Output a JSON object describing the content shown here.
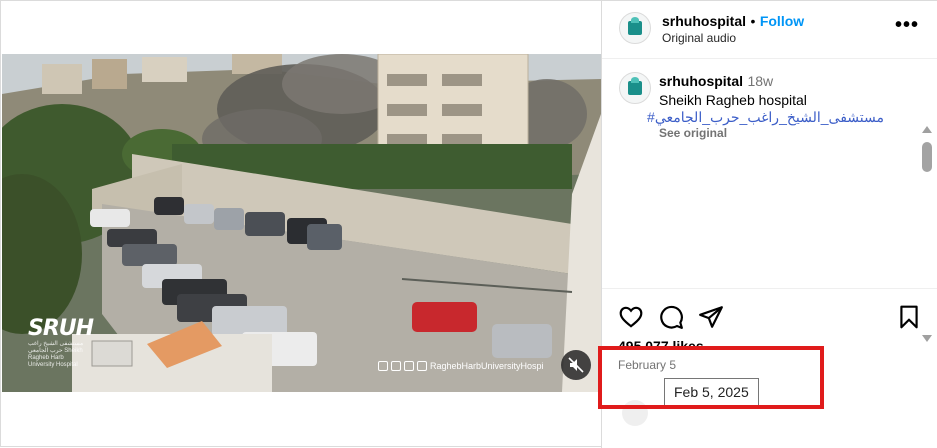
{
  "post": {
    "username": "srhuhospital",
    "separator": "•",
    "follow_label": "Follow",
    "audio": "Original audio",
    "more_label": "•••"
  },
  "caption": {
    "username": "srhuhospital",
    "age": "18w",
    "text": "Sheikh Ragheb hospital",
    "hashtag": "مستشفى_الشيخ_راغب_حرب_الجامعي#",
    "see_original": "See original"
  },
  "video": {
    "watermark_logo": "SRUH",
    "watermark_caption": "مستشفى الشيخ راغب حرب الجامعي Sheikh Ragheb Harb University Hospital",
    "social_handle": "RaghebHarbUniversityHospi"
  },
  "stats": {
    "likes": "495,077 likes",
    "date": "February 5",
    "date_tooltip": "Feb 5, 2025"
  },
  "icons": {
    "like": "heart-icon",
    "comment": "comment-icon",
    "share": "paper-plane-icon",
    "save": "bookmark-icon",
    "mute": "speaker-muted-icon",
    "more": "more-horizontal-icon"
  },
  "colors": {
    "follow": "#0095f6",
    "hashtag": "#3c5ec8",
    "highlight": "#e01b1b",
    "muted_text": "#737373"
  }
}
